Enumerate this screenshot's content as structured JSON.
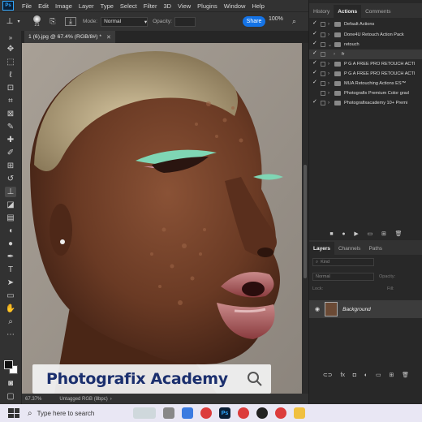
{
  "app": {
    "logo": "Ps"
  },
  "menu": [
    "File",
    "Edit",
    "Image",
    "Layer",
    "Type",
    "Select",
    "Filter",
    "3D",
    "View",
    "Plugins",
    "Window",
    "Help"
  ],
  "options": {
    "brush_size": "21",
    "mode_label": "Mode:",
    "mode_value": "Normal",
    "opacity_label": "Opacity:",
    "opacity_value": "100%",
    "share_label": "Share",
    "zoom_value": "100%"
  },
  "document": {
    "tab_title": "1 (6).jpg @ 67.4% (RGB/8#) *",
    "status_zoom": "67.37%",
    "status_info": "Untagged RGB (8bpc)"
  },
  "watermark": {
    "text": "Photografix Academy"
  },
  "actions_panel": {
    "tabs": [
      "History",
      "Actions",
      "Comments"
    ],
    "active_tab": "Actions",
    "rows": [
      {
        "label": "Default Actions",
        "checked": true
      },
      {
        "label": "Done4U Retouch Action Pack",
        "checked": true
      },
      {
        "label": "retouch",
        "checked": true,
        "expanded": true
      },
      {
        "label": "fr",
        "checked": true,
        "child": true
      },
      {
        "label": "P G A FREE PRO RETOUCH ACTI",
        "checked": true
      },
      {
        "label": "P G A FREE PRO RETOUCH ACTI",
        "checked": true
      },
      {
        "label": "MUA Retouching Actions ES™",
        "checked": true
      },
      {
        "label": "Photografix Premium Color grad",
        "checked": false
      },
      {
        "label": "Photografixacademy 10+ Premi",
        "checked": true
      }
    ]
  },
  "layers_panel": {
    "tabs": [
      "Layers",
      "Channels",
      "Paths"
    ],
    "active_tab": "Layers",
    "filter_label": "Kind",
    "blend_mode": "Normal",
    "opacity_label": "Opacity:",
    "lock_label": "Lock:",
    "fill_label": "Fill:",
    "layer_name": "Background"
  },
  "taskbar": {
    "search_placeholder": "Type here to search",
    "apps": [
      "edge",
      "photoshop",
      "chrome",
      "spotify",
      "chrome",
      "files"
    ]
  },
  "colors": {
    "accent": "#1473e6",
    "banner_text": "#1b2f6e",
    "panel_bg": "#282828"
  }
}
